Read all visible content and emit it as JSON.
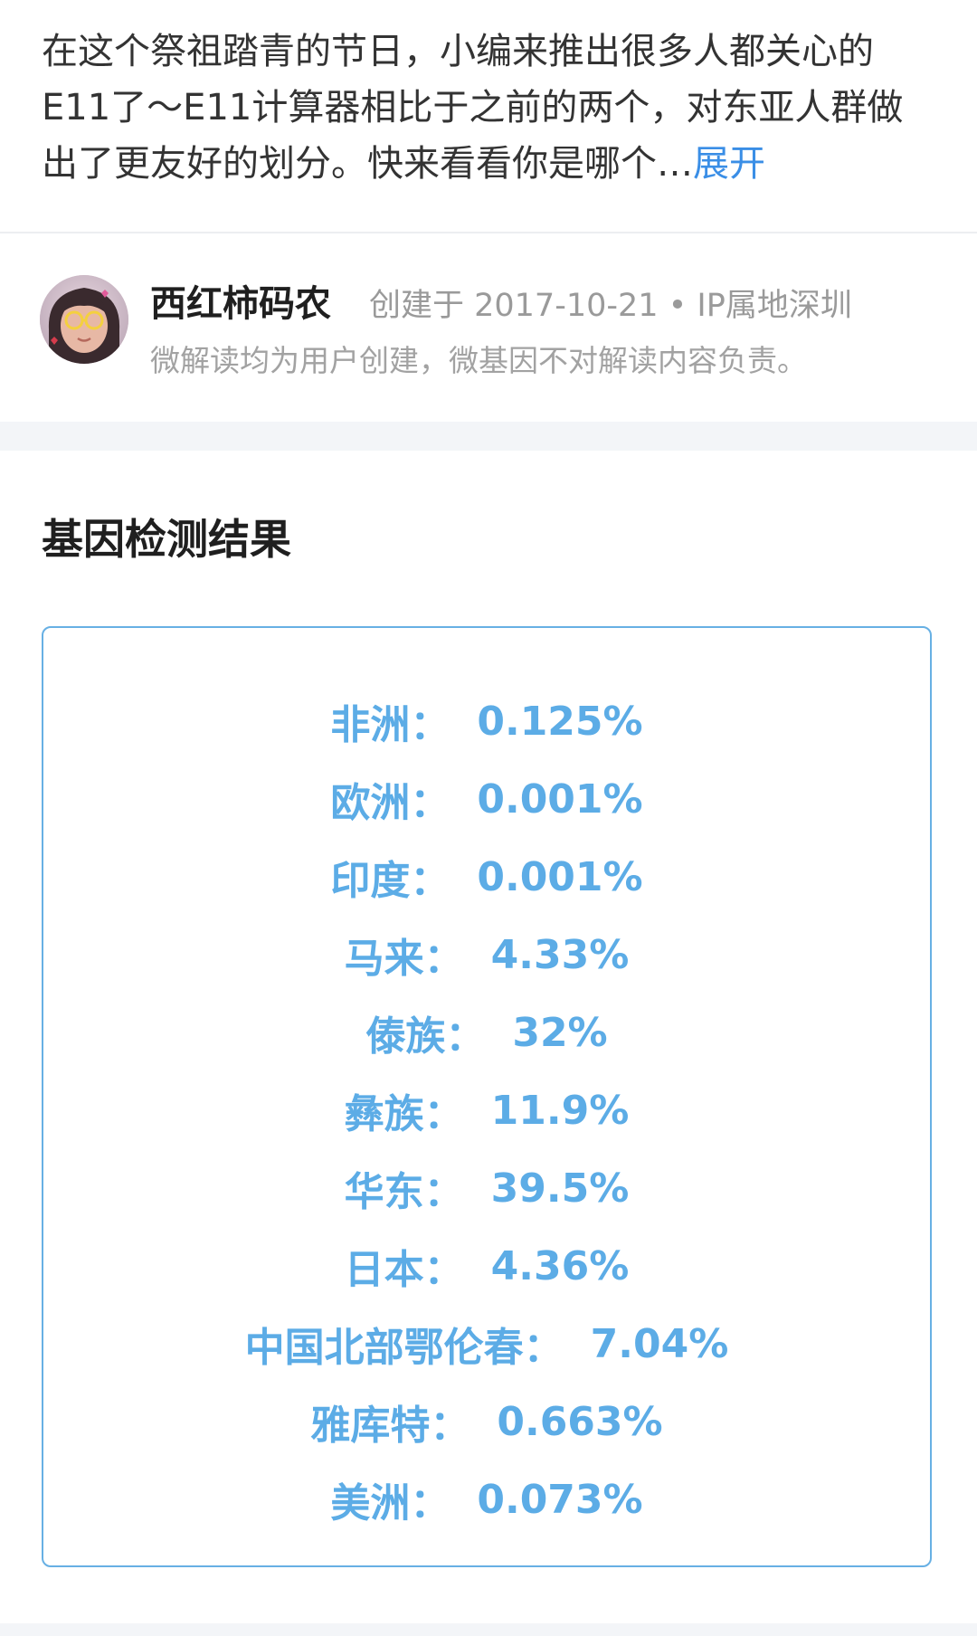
{
  "intro": {
    "text": "在这个祭祖踏青的节日，小编来推出很多人都关心的E11了～E11计算器相比于之前的两个，对东亚人群做出了更友好的划分。快来看看你是哪个…",
    "expand_label": "展开"
  },
  "author": {
    "name": "西红柿码农",
    "meta": "创建于 2017-10-21 • IP属地深圳",
    "disclaimer": "微解读均为用户创建，微基因不对解读内容负责。"
  },
  "section": {
    "title": "基因检测结果"
  },
  "results": {
    "separator": "：",
    "items": [
      {
        "label": "非洲",
        "value": "0.125%"
      },
      {
        "label": "欧洲",
        "value": "0.001%"
      },
      {
        "label": "印度",
        "value": "0.001%"
      },
      {
        "label": "马来",
        "value": "4.33%"
      },
      {
        "label": "傣族",
        "value": "32%"
      },
      {
        "label": "彝族",
        "value": "11.9%"
      },
      {
        "label": "华东",
        "value": "39.5%"
      },
      {
        "label": "日本",
        "value": "4.36%"
      },
      {
        "label": "中国北部鄂伦春",
        "value": "7.04%"
      },
      {
        "label": "雅库特",
        "value": "0.663%"
      },
      {
        "label": "美洲",
        "value": "0.073%"
      }
    ]
  },
  "colors": {
    "accent": "#5cace6",
    "link": "#3a8ee6",
    "box_border": "#67b0e4"
  }
}
